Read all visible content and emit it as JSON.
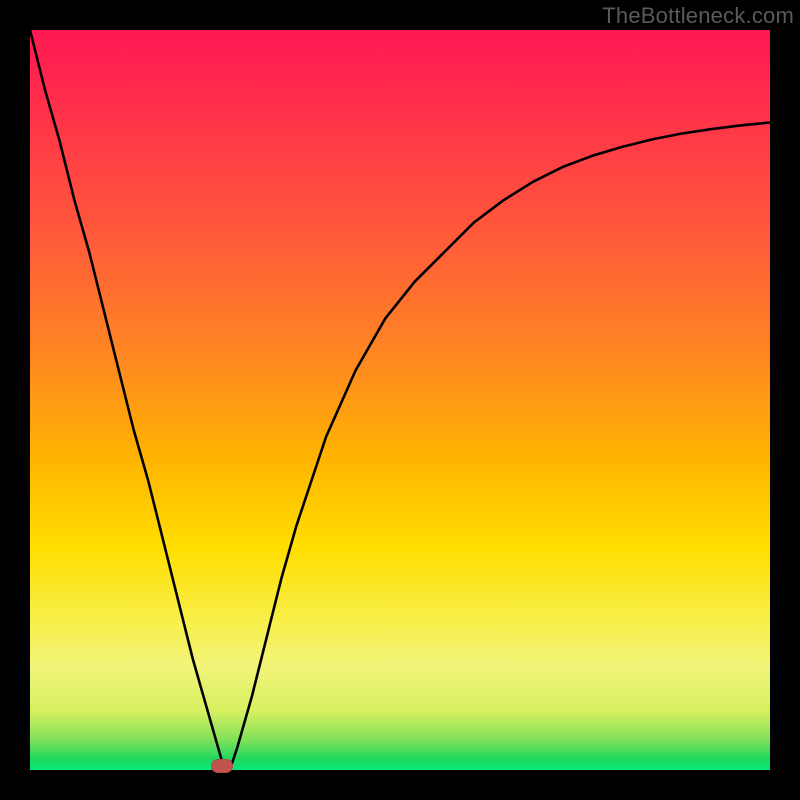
{
  "watermark": "TheBottleneck.com",
  "chart_data": {
    "type": "line",
    "title": "",
    "xlabel": "",
    "ylabel": "",
    "xlim": [
      0,
      100
    ],
    "ylim": [
      0,
      100
    ],
    "grid": false,
    "legend": false,
    "marker": {
      "x": 26,
      "y": 0.5,
      "shape": "pill",
      "color": "#c1544c"
    },
    "background_gradient_top_to_bottom": [
      "#ff1852",
      "#ff5a3a",
      "#ffb400",
      "#ffde00",
      "#f2f47a",
      "#1fd85e",
      "#06e879"
    ],
    "series": [
      {
        "name": "bottleneck-curve",
        "color": "#000000",
        "x": [
          0,
          2,
          4,
          6,
          8,
          10,
          12,
          14,
          16,
          18,
          20,
          22,
          24,
          26,
          27,
          28,
          30,
          32,
          34,
          36,
          38,
          40,
          44,
          48,
          52,
          56,
          60,
          64,
          68,
          72,
          76,
          80,
          84,
          88,
          92,
          96,
          100
        ],
        "values": [
          100,
          92,
          85,
          77,
          70,
          62,
          54,
          46,
          39,
          31,
          23,
          15,
          8,
          1,
          0,
          3,
          10,
          18,
          26,
          33,
          39,
          45,
          54,
          61,
          66,
          70,
          74,
          77,
          79.5,
          81.5,
          83,
          84.2,
          85.2,
          86,
          86.6,
          87.1,
          87.5
        ]
      }
    ]
  }
}
